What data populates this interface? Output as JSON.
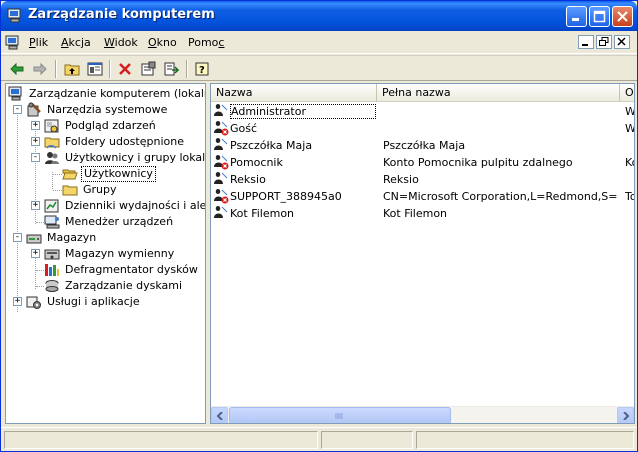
{
  "window": {
    "title": "Zarządzanie komputerem"
  },
  "menu": {
    "items": [
      {
        "label": "Plik",
        "key": "P",
        "rest": "lik"
      },
      {
        "label": "Akcja",
        "key": "A",
        "rest": "kcja"
      },
      {
        "label": "Widok",
        "key": "W",
        "rest": "idok"
      },
      {
        "label": "Okno",
        "key": "O",
        "rest": "kno"
      },
      {
        "label": "Pomoc",
        "key": "c",
        "pre": "Pomo"
      }
    ]
  },
  "toolbar": {
    "icons": [
      "back-arrow-icon",
      "forward-arrow-icon",
      "up-folder-icon",
      "show-hide-tree-icon",
      "delete-icon",
      "properties-icon",
      "export-list-icon",
      "help-icon"
    ]
  },
  "tree": {
    "root": "Zarządzanie komputerem (lokalne)",
    "system_tools": "Narzędzia systemowe",
    "event_viewer": "Podgląd zdarzeń",
    "shared_folders": "Foldery udostępnione",
    "users_groups": "Użytkownicy i grupy lokalne",
    "users": "Użytkownicy",
    "groups": "Grupy",
    "perf_logs": "Dzienniki wydajności i alerty",
    "device_manager": "Menedżer urządzeń",
    "storage": "Magazyn",
    "removable": "Magazyn wymienny",
    "defrag": "Defragmentator dysków",
    "disk_mgmt": "Zarządzanie dyskami",
    "services": "Usługi i aplikacje"
  },
  "list": {
    "columns": [
      "Nazwa",
      "Pełna nazwa",
      "O"
    ],
    "rows": [
      {
        "name": "Administrator",
        "full": "",
        "desc": "W",
        "disabled": false
      },
      {
        "name": "Gość",
        "full": "",
        "desc": "W",
        "disabled": true
      },
      {
        "name": "Pszczółka Maja",
        "full": "Pszczółka Maja",
        "desc": "",
        "disabled": false
      },
      {
        "name": "Pomocnik",
        "full": "Konto Pomocnika pulpitu zdalnego",
        "desc": "Ko",
        "disabled": true
      },
      {
        "name": "Reksio",
        "full": "Reksio",
        "desc": "",
        "disabled": false
      },
      {
        "name": "SUPPORT_388945a0",
        "full": "CN=Microsoft Corporation,L=Redmond,S=W...",
        "desc": "To",
        "disabled": true
      },
      {
        "name": "Kot Filemon",
        "full": "Kot Filemon",
        "desc": "",
        "disabled": false
      }
    ]
  }
}
